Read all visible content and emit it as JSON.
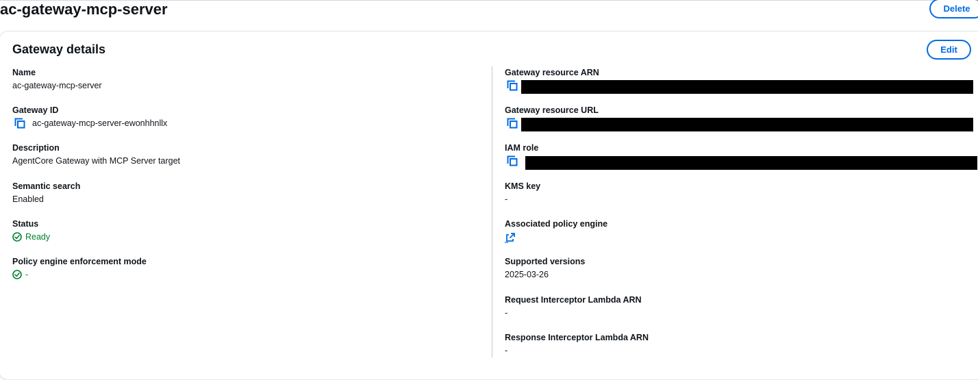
{
  "header": {
    "title": "ac-gateway-mcp-server",
    "delete_label": "Delete"
  },
  "panel": {
    "title": "Gateway details",
    "edit_label": "Edit"
  },
  "left": {
    "name": {
      "label": "Name",
      "value": "ac-gateway-mcp-server"
    },
    "gateway_id": {
      "label": "Gateway ID",
      "value": "ac-gateway-mcp-server-ewonhhnllx"
    },
    "description": {
      "label": "Description",
      "value": "AgentCore Gateway with MCP Server target"
    },
    "semantic_search": {
      "label": "Semantic search",
      "value": "Enabled"
    },
    "status": {
      "label": "Status",
      "value": "Ready"
    },
    "policy_mode": {
      "label": "Policy engine enforcement mode",
      "value": "-"
    }
  },
  "right": {
    "arn": {
      "label": "Gateway resource ARN"
    },
    "url": {
      "label": "Gateway resource URL"
    },
    "iam_role": {
      "label": "IAM role"
    },
    "kms_key": {
      "label": "KMS key",
      "value": "-"
    },
    "policy_engine": {
      "label": "Associated policy engine"
    },
    "versions": {
      "label": "Supported versions",
      "value": "2025-03-26"
    },
    "req_interceptor": {
      "label": "Request Interceptor Lambda ARN",
      "value": "-"
    },
    "resp_interceptor": {
      "label": "Response Interceptor Lambda ARN",
      "value": "-"
    }
  },
  "icons": {
    "copy": "copy-icon",
    "status_ok": "status-positive-icon",
    "external": "external-link-icon"
  },
  "colors": {
    "accent": "#006ce0",
    "success": "#00802f",
    "text": "#0f141a"
  }
}
